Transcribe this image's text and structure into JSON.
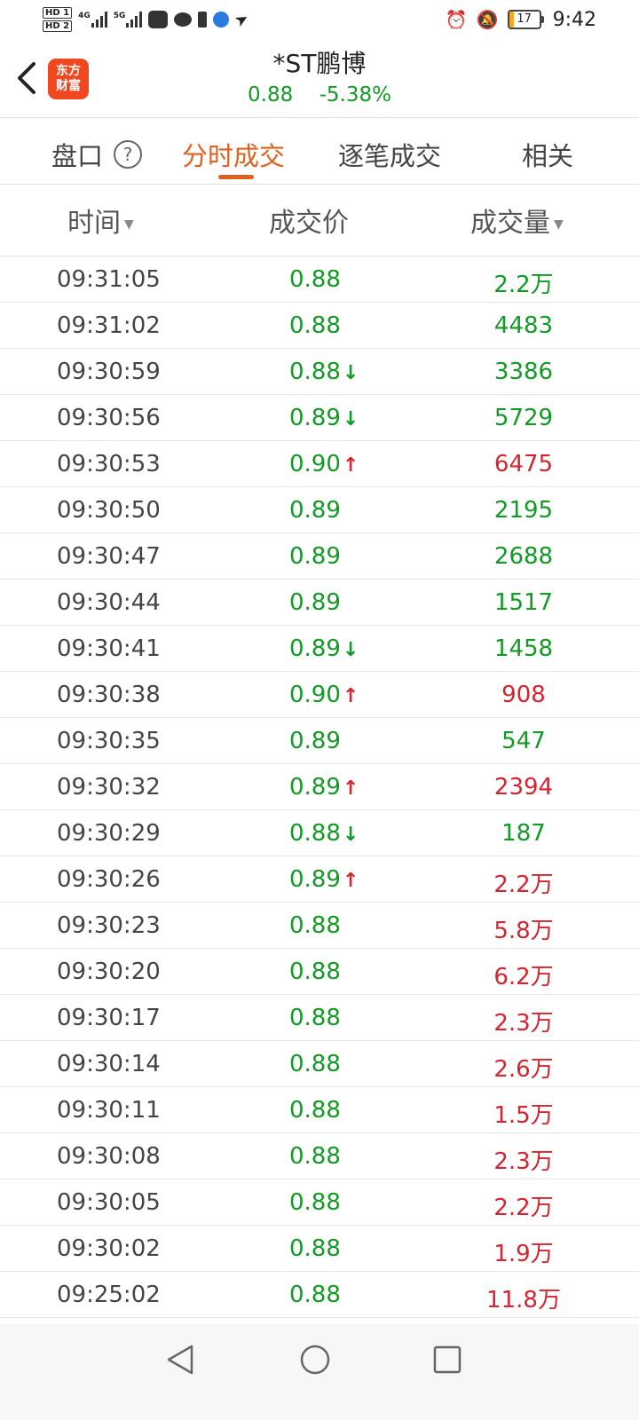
{
  "status_bar": {
    "hd1": "HD 1",
    "hd2": "HD 2",
    "signal1_label": "4G",
    "signal2_label": "5G",
    "battery_level": "17",
    "battery_fraction": 0.17,
    "time": "9:42"
  },
  "header": {
    "logo_line1": "东方",
    "logo_line2": "财富",
    "stock_name": "*ST鹏博",
    "price": "0.88",
    "change_pct": "-5.38%"
  },
  "tabs": {
    "pankou": "盘口",
    "help": "?",
    "fenshi": "分时成交",
    "zhubi": "逐笔成交",
    "xiangguan": "相关"
  },
  "columns": {
    "time": "时间",
    "price": "成交价",
    "volume": "成交量"
  },
  "rows": [
    {
      "time": "09:31:05",
      "price": "0.88",
      "arrow": "",
      "volume": "2.2万",
      "vol_dir": "green"
    },
    {
      "time": "09:31:02",
      "price": "0.88",
      "arrow": "",
      "volume": "4483",
      "vol_dir": "green"
    },
    {
      "time": "09:30:59",
      "price": "0.88",
      "arrow": "down",
      "volume": "3386",
      "vol_dir": "green"
    },
    {
      "time": "09:30:56",
      "price": "0.89",
      "arrow": "down",
      "volume": "5729",
      "vol_dir": "green"
    },
    {
      "time": "09:30:53",
      "price": "0.90",
      "arrow": "up",
      "volume": "6475",
      "vol_dir": "red"
    },
    {
      "time": "09:30:50",
      "price": "0.89",
      "arrow": "",
      "volume": "2195",
      "vol_dir": "green"
    },
    {
      "time": "09:30:47",
      "price": "0.89",
      "arrow": "",
      "volume": "2688",
      "vol_dir": "green"
    },
    {
      "time": "09:30:44",
      "price": "0.89",
      "arrow": "",
      "volume": "1517",
      "vol_dir": "green"
    },
    {
      "time": "09:30:41",
      "price": "0.89",
      "arrow": "down",
      "volume": "1458",
      "vol_dir": "green"
    },
    {
      "time": "09:30:38",
      "price": "0.90",
      "arrow": "up",
      "volume": "908",
      "vol_dir": "red"
    },
    {
      "time": "09:30:35",
      "price": "0.89",
      "arrow": "",
      "volume": "547",
      "vol_dir": "green"
    },
    {
      "time": "09:30:32",
      "price": "0.89",
      "arrow": "up",
      "volume": "2394",
      "vol_dir": "red"
    },
    {
      "time": "09:30:29",
      "price": "0.88",
      "arrow": "down",
      "volume": "187",
      "vol_dir": "green"
    },
    {
      "time": "09:30:26",
      "price": "0.89",
      "arrow": "up",
      "volume": "2.2万",
      "vol_dir": "red"
    },
    {
      "time": "09:30:23",
      "price": "0.88",
      "arrow": "",
      "volume": "5.8万",
      "vol_dir": "red"
    },
    {
      "time": "09:30:20",
      "price": "0.88",
      "arrow": "",
      "volume": "6.2万",
      "vol_dir": "red"
    },
    {
      "time": "09:30:17",
      "price": "0.88",
      "arrow": "",
      "volume": "2.3万",
      "vol_dir": "red"
    },
    {
      "time": "09:30:14",
      "price": "0.88",
      "arrow": "",
      "volume": "2.6万",
      "vol_dir": "red"
    },
    {
      "time": "09:30:11",
      "price": "0.88",
      "arrow": "",
      "volume": "1.5万",
      "vol_dir": "red"
    },
    {
      "time": "09:30:08",
      "price": "0.88",
      "arrow": "",
      "volume": "2.3万",
      "vol_dir": "red"
    },
    {
      "time": "09:30:05",
      "price": "0.88",
      "arrow": "",
      "volume": "2.2万",
      "vol_dir": "red"
    },
    {
      "time": "09:30:02",
      "price": "0.88",
      "arrow": "",
      "volume": "1.9万",
      "vol_dir": "red"
    },
    {
      "time": "09:25:02",
      "price": "0.88",
      "arrow": "",
      "volume": "11.8万",
      "vol_dir": "red"
    }
  ],
  "icons": {
    "up_arrow": "↑",
    "down_arrow": "↓",
    "caret_down": "▼"
  },
  "colors": {
    "green": "#119b24",
    "red": "#d6242e",
    "accent": "#e0601f",
    "logo_bg": "#f0471e"
  }
}
